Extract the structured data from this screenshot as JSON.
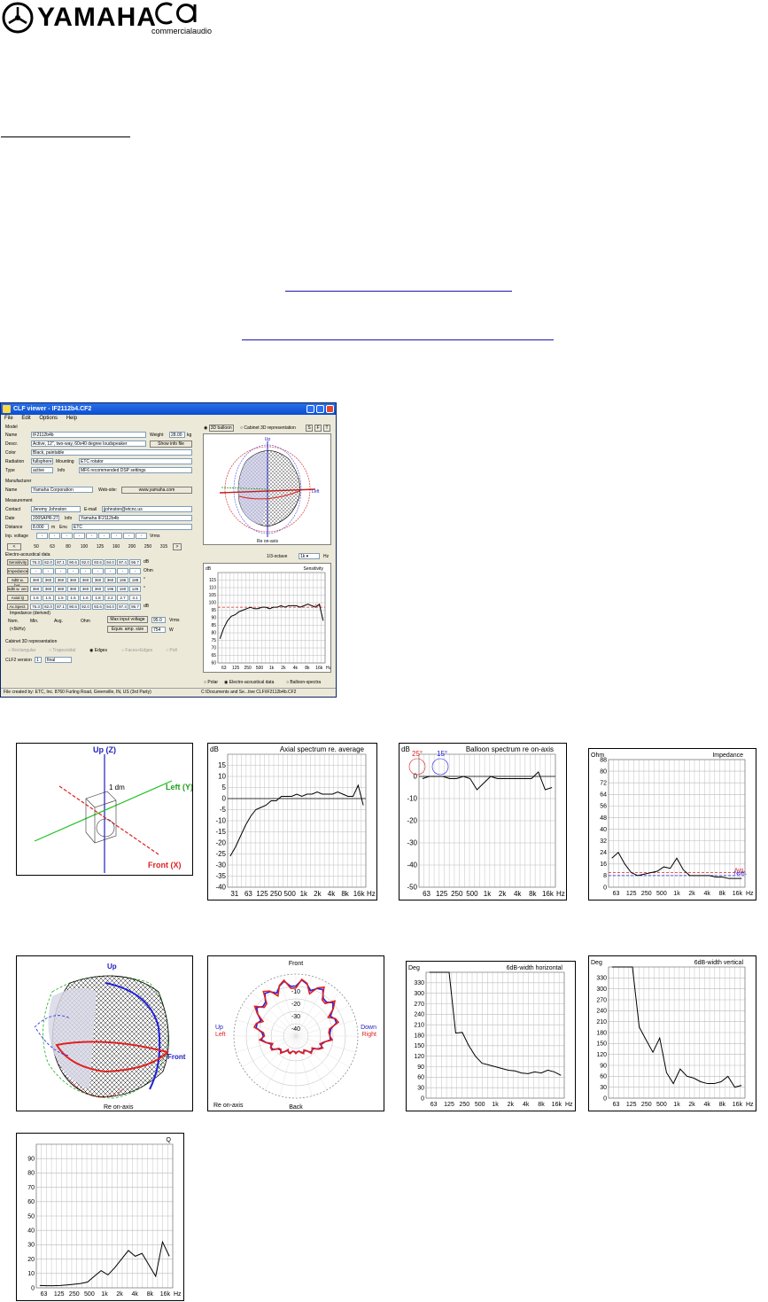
{
  "header": {
    "brand_logo": "YAMAHA",
    "ca_logo_text": "commercialaudio"
  },
  "window": {
    "title": "CLF viewer - IF2112b4.CF2",
    "menu": [
      "File",
      "Edit",
      "Options",
      "Help"
    ],
    "model": {
      "section": "Model",
      "name_label": "Name",
      "name": "IF2112b4b",
      "weight_label": "Weight",
      "weight": "28.00",
      "weight_unit": "kg",
      "desc_label": "Descr.",
      "desc": "Active, 12\", two-way, 60x40 degree loudspeaker",
      "show_info": "Show info file",
      "color_label": "Color",
      "color": "Black, paintable",
      "radiation_label": "Radiation",
      "radiation": "fullsphere",
      "mounting_label": "Mounting",
      "mounting": "ETC rotator",
      "type_label": "Type",
      "type": "active",
      "info_label": "Info",
      "info": "MF6 recommended DSP settings"
    },
    "manufacturer": {
      "section": "Manufacturer",
      "name_label": "Name",
      "name": "Yamaha Corporation",
      "web_label": "Web-site:",
      "web": "www.yamaha.com"
    },
    "measurement": {
      "section": "Measurement",
      "contact_label": "Contact",
      "contact": "Jeremy Johnston",
      "email_label": "E-mail",
      "email": "jjohnston@etcnc.us",
      "date_label": "Date",
      "date": "2005APR-27",
      "info_label": "Info",
      "info": "Yamaha IF2112b4b",
      "distance_label": "Distance",
      "distance": "8.000",
      "distance_unit": "m",
      "env_label": "Env.",
      "env": "ETC",
      "inp_label": "Inp. voltage",
      "vrms": "Vrms"
    },
    "freqs": [
      "50",
      "63",
      "80",
      "100",
      "125",
      "160",
      "200",
      "250",
      "315"
    ],
    "ea_section": "Electro-acoustical data",
    "rows": [
      {
        "label": "Sensitivity",
        "values": [
          "76.3",
          "82.0",
          "87.1",
          "90.6",
          "92.0",
          "93.6",
          "94.0",
          "97.4",
          "96.7"
        ],
        "unit": "dB"
      },
      {
        "label": "Impedance",
        "values": [
          "-",
          "-",
          "-",
          "-",
          "-",
          "-",
          "-",
          "-",
          "-"
        ],
        "unit": "Ohm"
      },
      {
        "label": "6dB w. hor.",
        "values": [
          "360",
          "360",
          "360",
          "360",
          "360",
          "360",
          "360",
          "186",
          "188"
        ],
        "unit": "°"
      },
      {
        "label": "6dB w. ver.",
        "values": [
          "360",
          "360",
          "360",
          "360",
          "360",
          "360",
          "195",
          "160",
          "126"
        ],
        "unit": "°"
      },
      {
        "label": "Axial Q",
        "values": [
          "1.6",
          "1.5",
          "1.5",
          "1.5",
          "1.6",
          "1.8",
          "2.2",
          "2.7",
          "3.1"
        ],
        "unit": ""
      },
      {
        "label": "Ax.Spect.",
        "values": [
          "76.3",
          "82.0",
          "87.1",
          "90.6",
          "92.0",
          "93.6",
          "94.0",
          "97.4",
          "96.7"
        ],
        "unit": "dB"
      }
    ],
    "impedance": {
      "section": "Impedance (derived)",
      "nom": "Nom.",
      "min": "Min.",
      "avg": "Avg.",
      "unit": "Ohm",
      "range": "(<5kHz)",
      "max_voltage_label": "Max input voltage",
      "max_voltage": "95.0",
      "max_voltage_unit": "Vrms",
      "equiv_label": "Equiv. amp. size",
      "equiv": "754",
      "equiv_unit": "W"
    },
    "cab3d": {
      "section": "Cabinet 3D representation",
      "options": [
        "Rectangular",
        "Trapezoidal",
        "Edges",
        "Faces+Edges",
        "Poll"
      ]
    },
    "version_label": "CLF2",
    "version_word": "version",
    "version": "1",
    "version_state": "final",
    "balloon_tabs": [
      "3D balloon",
      "Cabinet 3D representation"
    ],
    "view_btns": [
      "S",
      "F",
      "T"
    ],
    "octave_label": "1/3-octave",
    "octave_value": "1k",
    "hz": "Hz",
    "bottom_opts": [
      "Polar",
      "Electro-acoustical data",
      "Balloon-spectra"
    ],
    "status_left": "File created by: ETC, Inc. 8760 Furling Road, Greenville, IN, US (3rd Party)",
    "status_right": "C:\\Documents and Se...tive  CLF\\IF2112b4b.CF2"
  },
  "charts": {
    "sensitivity": {
      "title": "Sensitivity",
      "unit": "dB",
      "avg": "Avg."
    },
    "axial": {
      "title": "Axial spectrum re. average",
      "unit": "dB"
    },
    "balloon_spec": {
      "title": "Balloon spectrum re on-axis",
      "unit": "dB",
      "angle1": "25°",
      "angle2": "15°"
    },
    "impedance": {
      "title": "Impedance",
      "unit": "Ohm",
      "avg": "Avg.",
      "nom": "Nom."
    },
    "hor": {
      "title": "6dB-width horizontal",
      "unit": "Deg"
    },
    "ver": {
      "title": "6dB-width vertical",
      "unit": "Deg"
    },
    "q": {
      "title": "Q"
    },
    "axes3d": {
      "up": "Up (Z)",
      "left": "Left (Y)",
      "front": "Front (X)",
      "dm": "1 dm"
    },
    "balloon1": {
      "up": "Up",
      "left": "Left",
      "reaxis": "Re on-axis"
    },
    "balloon2": {
      "up": "Up",
      "front": "Front",
      "reaxis": "Re on-axis"
    },
    "polar": {
      "front": "Front",
      "back": "Back",
      "up": "Up",
      "left": "Left",
      "down": "Down",
      "right": "Right",
      "reaxis": "Re on-axis",
      "rings": [
        "-10",
        "-20",
        "-30",
        "-40"
      ]
    }
  },
  "chart_data": [
    {
      "type": "line",
      "title": "Sensitivity",
      "ylabel": "dB",
      "categories": [
        "63",
        "125",
        "250",
        "500",
        "1k",
        "2k",
        "4k",
        "8k",
        "16k"
      ],
      "ylim": [
        60,
        120
      ],
      "yticks": [
        "60",
        "65",
        "70",
        "75",
        "80",
        "85",
        "90",
        "95",
        "100",
        "105",
        "110",
        "115"
      ],
      "values": [
        76,
        83,
        88,
        91,
        92,
        94,
        95,
        96,
        97,
        96,
        96,
        97,
        97,
        96,
        97,
        97,
        98,
        97,
        98,
        98,
        98,
        97,
        98,
        99,
        98,
        97,
        99,
        88
      ]
    },
    {
      "type": "line",
      "title": "Axial spectrum re. average",
      "ylabel": "dB",
      "categories": [
        "31",
        "63",
        "125",
        "250",
        "500",
        "1k",
        "2k",
        "4k",
        "8k",
        "16k"
      ],
      "ylim": [
        -40,
        20
      ],
      "yticks": [
        "15",
        "10",
        "5",
        "0",
        "-5",
        "-10",
        "-15",
        "-20",
        "-25",
        "-30",
        "-35",
        "-40"
      ],
      "values": [
        -26,
        -22,
        -17,
        -12,
        -8,
        -5,
        -4,
        -3,
        -1,
        -1,
        1,
        1,
        1,
        2,
        1,
        2,
        2,
        3,
        2,
        2,
        2,
        3,
        2,
        1,
        1,
        6,
        -3
      ]
    },
    {
      "type": "line",
      "title": "Balloon spectrum re on-axis",
      "ylabel": "dB",
      "categories": [
        "63",
        "125",
        "250",
        "500",
        "1k",
        "2k",
        "4k",
        "8k",
        "16k"
      ],
      "ylim": [
        -50,
        10
      ],
      "yticks": [
        "0",
        "-10",
        "-20",
        "-30",
        "-40",
        "-50"
      ],
      "values": [
        -1,
        0,
        0,
        0,
        -1,
        -1,
        0,
        -1,
        -6,
        -3,
        0,
        -1,
        -1,
        -1,
        -1,
        -1,
        -1,
        2,
        -6,
        -5
      ]
    },
    {
      "type": "line",
      "title": "Impedance",
      "ylabel": "Ohm",
      "categories": [
        "63",
        "125",
        "250",
        "500",
        "1k",
        "2k",
        "4k",
        "8k",
        "16k"
      ],
      "ylim": [
        0,
        88
      ],
      "yticks": [
        "88",
        "80",
        "72",
        "64",
        "56",
        "48",
        "40",
        "32",
        "24",
        "16",
        "8",
        "0"
      ],
      "values": [
        20,
        24,
        16,
        10,
        8,
        9,
        10,
        11,
        14,
        13,
        20,
        12,
        8,
        8,
        8,
        8,
        7,
        7,
        6,
        6,
        6
      ]
    },
    {
      "type": "line",
      "title": "6dB-width horizontal",
      "ylabel": "Deg",
      "categories": [
        "63",
        "125",
        "250",
        "500",
        "1k",
        "2k",
        "4k",
        "8k",
        "16k"
      ],
      "ylim": [
        0,
        360
      ],
      "yticks": [
        "330",
        "300",
        "270",
        "240",
        "210",
        "180",
        "150",
        "120",
        "90",
        "60",
        "30",
        "0"
      ],
      "values": [
        360,
        360,
        360,
        360,
        186,
        188,
        150,
        120,
        100,
        95,
        90,
        85,
        80,
        78,
        72,
        70,
        75,
        72,
        80,
        75,
        65
      ]
    },
    {
      "type": "line",
      "title": "6dB-width vertical",
      "ylabel": "Deg",
      "categories": [
        "63",
        "125",
        "250",
        "500",
        "1k",
        "2k",
        "4k",
        "8k",
        "16k"
      ],
      "ylim": [
        0,
        360
      ],
      "yticks": [
        "330",
        "300",
        "270",
        "240",
        "210",
        "180",
        "150",
        "120",
        "90",
        "60",
        "30",
        "0"
      ],
      "values": [
        360,
        360,
        360,
        360,
        195,
        160,
        126,
        165,
        70,
        40,
        80,
        60,
        55,
        45,
        40,
        40,
        45,
        60,
        30,
        35
      ]
    },
    {
      "type": "line",
      "title": "Q",
      "categories": [
        "63",
        "125",
        "250",
        "500",
        "1k",
        "2k",
        "4k",
        "8k",
        "16k"
      ],
      "ylim": [
        0,
        100
      ],
      "yticks": [
        "90",
        "80",
        "70",
        "60",
        "50",
        "40",
        "30",
        "20",
        "10",
        "0"
      ],
      "values": [
        1.6,
        1.5,
        1.5,
        1.6,
        2,
        2.5,
        3,
        4,
        8,
        12,
        9,
        14,
        20,
        26,
        22,
        24,
        16,
        8,
        32,
        22
      ]
    }
  ]
}
